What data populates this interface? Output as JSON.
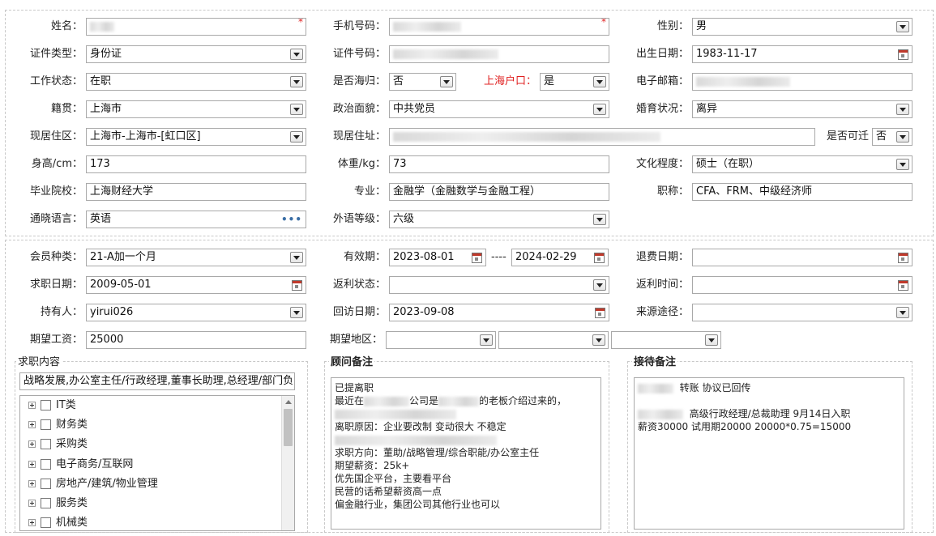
{
  "basic": {
    "name_label": "姓名：",
    "phone_label": "手机号码：",
    "gender_label": "性别：",
    "gender_value": "男",
    "id_type_label": "证件类型：",
    "id_type_value": "身份证",
    "id_number_label": "证件号码：",
    "birth_label": "出生日期：",
    "birth_value": "1983-11-17",
    "work_status_label": "工作状态：",
    "work_status_value": "在职",
    "returnee_label": "是否海归：",
    "returnee_value": "否",
    "sh_hukou_label": "上海户口：",
    "sh_hukou_value": "是",
    "email_label": "电子邮箱：",
    "native_label": "籍贯：",
    "native_value": "上海市",
    "political_label": "政治面貌：",
    "political_value": "中共党员",
    "marital_label": "婚育状况：",
    "marital_value": "离异",
    "residence_area_label": "现居住区：",
    "residence_area_value": "上海市-上海市-[虹口区]",
    "residence_addr_label": "现居住址：",
    "relocate_label": "是否可迁",
    "relocate_value": "否",
    "height_label": "身高/cm：",
    "height_value": "173",
    "weight_label": "体重/kg：",
    "weight_value": "73",
    "education_label": "文化程度：",
    "education_value": "硕士（在职）",
    "school_label": "毕业院校：",
    "school_value": "上海财经大学",
    "major_label": "专业：",
    "major_value": "金融学（金融数学与金融工程）",
    "title_label": "职称：",
    "title_value": "CFA、FRM、中级经济师",
    "languages_label": "通晓语言：",
    "languages_value": "英语",
    "languages_more": "•••",
    "lang_level_label": "外语等级：",
    "lang_level_value": "六级"
  },
  "membership": {
    "member_type_label": "会员种类：",
    "member_type_value": "21-A加一个月",
    "validity_label": "有效期：",
    "validity_start": "2023-08-01",
    "validity_sep": "----",
    "validity_end": "2024-02-29",
    "refund_date_label": "退费日期：",
    "job_date_label": "求职日期：",
    "job_date_value": "2009-05-01",
    "rebate_status_label": "返利状态：",
    "rebate_time_label": "返利时间：",
    "holder_label": "持有人：",
    "holder_value": "yirui026",
    "visit_date_label": "回访日期：",
    "visit_date_value": "2023-09-08",
    "source_label": "来源途径：",
    "salary_label": "期望工资：",
    "salary_value": "25000",
    "region_label": "期望地区："
  },
  "job_content": {
    "title": "求职内容",
    "summary": "战略发展,办公室主任/行政经理,董事长助理,总经理/部门负",
    "categories": [
      "IT类",
      "财务类",
      "采购类",
      "电子商务/互联网",
      "房地产/建筑/物业管理",
      "服务类",
      "机械类"
    ]
  },
  "consultant_notes": {
    "title": "顾问备注",
    "lines": [
      {
        "pre": "已提离职",
        "post": ""
      },
      {
        "pre": "最近在",
        "post": "公司是",
        "post2": "的老板介绍过来的，"
      },
      {
        "pre": "",
        "post": ""
      },
      {
        "pre": "离职原因：企业要改制 变动很大 不稳定",
        "post": ""
      },
      {
        "pre": "",
        "post": ""
      },
      {
        "pre": "求职方向：董助/战略管理/综合职能/办公室主任",
        "post": ""
      },
      {
        "pre": "期望薪资：25k+",
        "post": ""
      },
      {
        "pre": "优先国企平台，主要看平台",
        "post": ""
      },
      {
        "pre": "民营的话希望薪资高一点",
        "post": ""
      },
      {
        "pre": "偏金融行业，集团公司其他行业也可以",
        "post": ""
      }
    ]
  },
  "reception_notes": {
    "title": "接待备注",
    "line1": "转账   协议已回传",
    "line2": "高级行政经理/总裁助理  9月14日入职",
    "line3": "薪资30000 试用期20000    20000*0.75=15000"
  },
  "colors": {
    "required": "#e02020",
    "border": "#a9a9a9",
    "scroll_thumb": "#c1c1c1"
  },
  "icons": {
    "dropdown": "chevron-down-icon",
    "calendar": "calendar-icon",
    "expand": "plus-box-icon",
    "checkbox": "checkbox-icon",
    "more": "ellipsis-icon"
  }
}
